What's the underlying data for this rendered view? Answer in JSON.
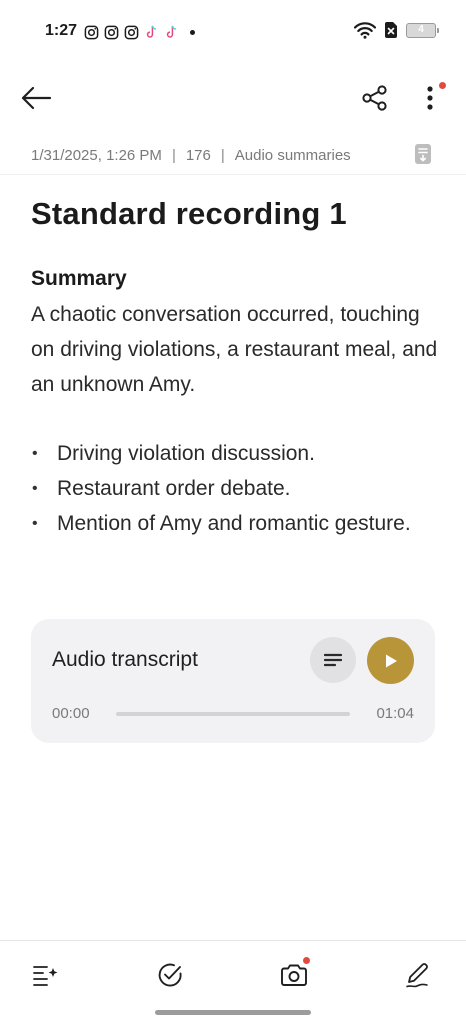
{
  "status_bar": {
    "time": "1:27",
    "apps": [
      "instagram-icon",
      "instagram-icon",
      "instagram-icon",
      "tiktok-icon",
      "tiktok-icon"
    ],
    "battery_level": "4"
  },
  "app_bar": {
    "back": "back-arrow-icon",
    "share": "share-icon",
    "more": "more-vert-icon"
  },
  "meta": {
    "datetime": "1/31/2025, 1:26 PM",
    "separator": "|",
    "count": "176",
    "category": "Audio summaries"
  },
  "note": {
    "title": "Standard recording 1",
    "summary_heading": "Summary",
    "summary_text": "A chaotic conversation occurred, touching on driving violations, a restaurant meal, and an unknown Amy.",
    "bullet_mark": "•",
    "bullets": [
      "Driving violation discussion.",
      "Restaurant order debate.",
      "Mention of Amy and romantic gesture."
    ]
  },
  "audio": {
    "title": "Audio transcript",
    "current_time": "00:00",
    "duration": "01:04",
    "progress_fraction": 0,
    "play_color": "#b79538"
  },
  "bottom_toolbar": {
    "items": [
      "ai-list-sparkle-icon",
      "check-circle-icon",
      "camera-icon",
      "pen-icon"
    ]
  },
  "colors": {
    "accent": "#b79538",
    "notification_dot": "#e04a3f",
    "card_background": "#f2f2f5"
  }
}
